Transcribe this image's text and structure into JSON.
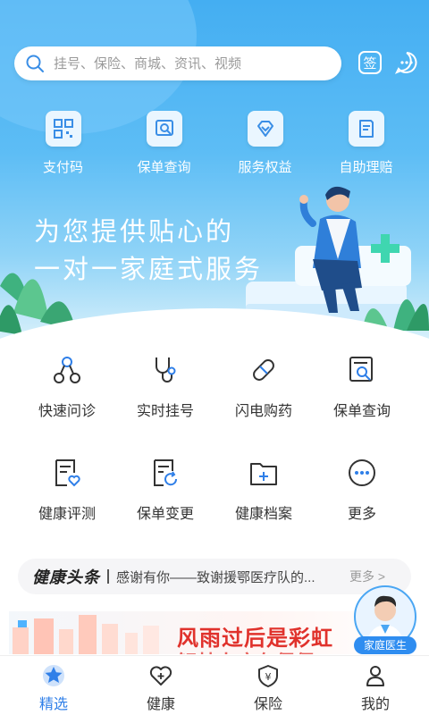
{
  "search": {
    "placeholder": "挂号、保险、商城、资讯、视频"
  },
  "header_actions": {
    "sign_in_icon_text": "签"
  },
  "quick_actions": [
    {
      "label": "支付码",
      "icon": "qr-code-icon"
    },
    {
      "label": "保单查询",
      "icon": "policy-search-icon"
    },
    {
      "label": "服务权益",
      "icon": "diamond-icon"
    },
    {
      "label": "自助理赔",
      "icon": "claim-icon"
    }
  ],
  "hero": {
    "line1": "为您提供贴心的",
    "line2": "一对一家庭式服务"
  },
  "services": [
    {
      "label": "快速问诊",
      "icon": "consult-icon"
    },
    {
      "label": "实时挂号",
      "icon": "stethoscope-icon"
    },
    {
      "label": "闪电购药",
      "icon": "pill-icon"
    },
    {
      "label": "保单查询",
      "icon": "policy-search-icon"
    },
    {
      "label": "健康评测",
      "icon": "health-assessment-icon"
    },
    {
      "label": "保单变更",
      "icon": "policy-change-icon"
    },
    {
      "label": "健康档案",
      "icon": "health-record-icon"
    },
    {
      "label": "更多",
      "icon": "more-icon"
    }
  ],
  "news": {
    "logo": "健康头条",
    "headline": "感谢有你——致谢援鄂医疗队的...",
    "more": "更多 >"
  },
  "banner": {
    "title": "风雨过后是彩虹",
    "subtitle": "解禁大疫有保保"
  },
  "doctor": {
    "label": "家庭医生"
  },
  "tabs": [
    {
      "label": "精选",
      "icon": "star-icon",
      "active": true
    },
    {
      "label": "健康",
      "icon": "heart-icon",
      "active": false
    },
    {
      "label": "保险",
      "icon": "shield-icon",
      "active": false
    },
    {
      "label": "我的",
      "icon": "user-icon",
      "active": false
    }
  ],
  "colors": {
    "accent": "#2f7fe8",
    "hero_top": "#44aef2",
    "banner_red": "#e0322c"
  }
}
